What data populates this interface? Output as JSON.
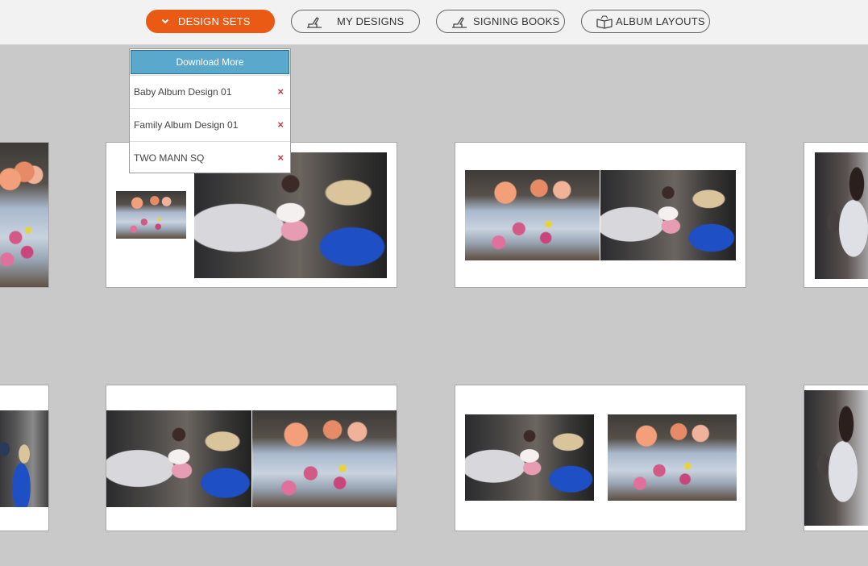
{
  "toolbar": {
    "buttons": [
      {
        "label": "DESIGN SETS",
        "icon": "chevron-down-icon",
        "active": true
      },
      {
        "label": "MY DESIGNS",
        "icon": "hand-pen-icon",
        "active": false
      },
      {
        "label": "SIGNING BOOKS",
        "icon": "hand-pen-icon",
        "active": false
      },
      {
        "label": "ALBUM LAYOUTS",
        "icon": "open-album-icon",
        "active": false
      }
    ]
  },
  "dropdown": {
    "download_label": "Download More",
    "items": [
      {
        "label": "Baby Album Design 01",
        "remove": "×"
      },
      {
        "label": "Family Album Design 01",
        "remove": "×"
      },
      {
        "label": "TWO MANN SQ",
        "remove": "×"
      }
    ]
  },
  "colors": {
    "accent": "#ea5a14",
    "download": "#5aa9cc",
    "remove": "#d0353f",
    "canvas": "#c9c9c9"
  }
}
